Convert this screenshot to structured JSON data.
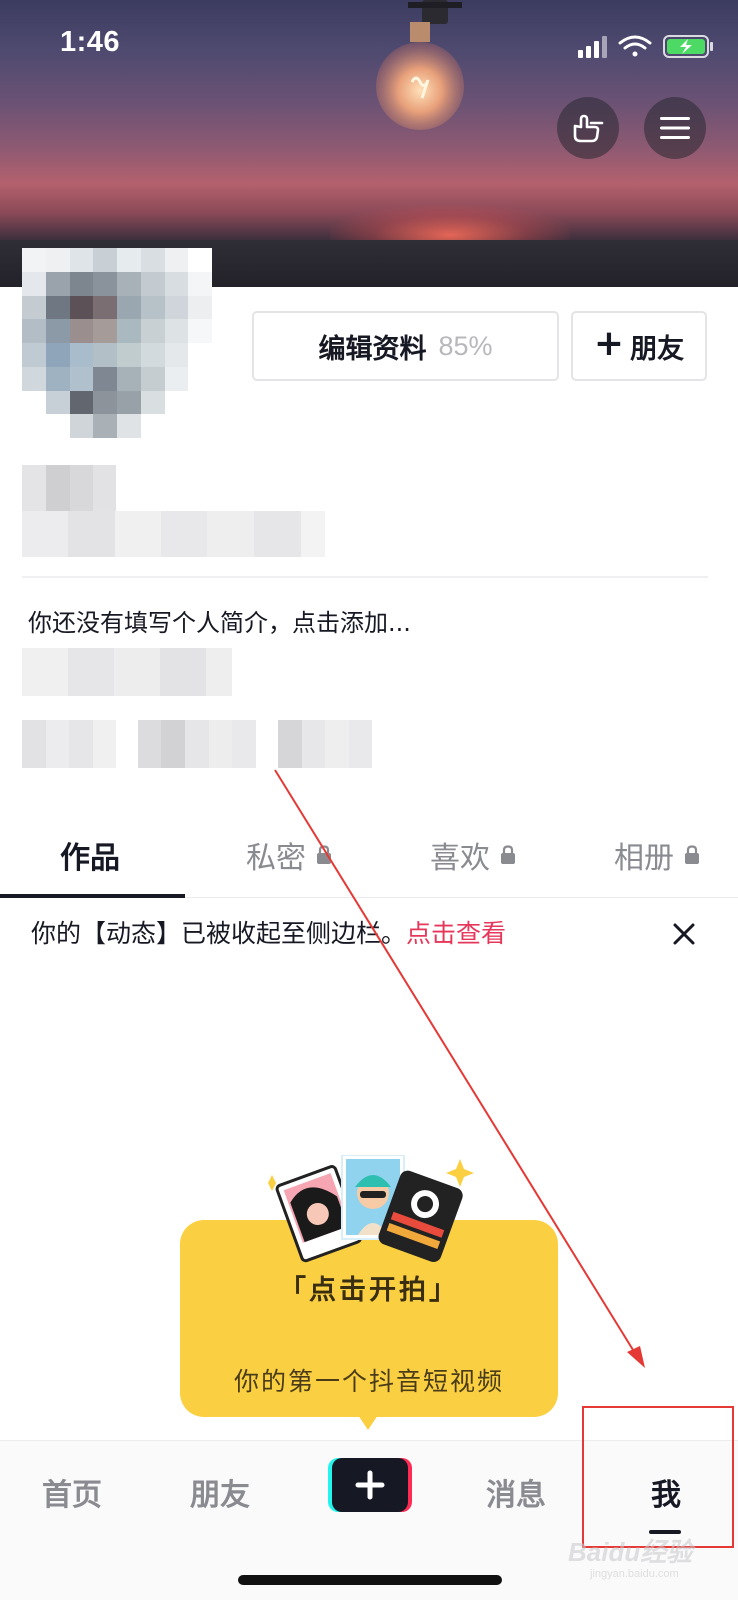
{
  "status_bar": {
    "time": "1:46"
  },
  "profile": {
    "edit_label": "编辑资料",
    "edit_percent": "85%",
    "add_friend_label": "朋友",
    "bio_placeholder": "你还没有填写个人简介，点击添加..."
  },
  "tabs": [
    {
      "label": "作品",
      "active": true,
      "locked": false
    },
    {
      "label": "私密",
      "active": false,
      "locked": true
    },
    {
      "label": "喜欢",
      "active": false,
      "locked": true
    },
    {
      "label": "相册",
      "active": false,
      "locked": true
    }
  ],
  "notice": {
    "text": "你的【动态】已被收起至侧边栏。",
    "link": "点击查看"
  },
  "tooltip": {
    "title": "「点击开拍」",
    "subtitle": "你的第一个抖音短视频"
  },
  "bottom_nav": {
    "home": "首页",
    "friends": "朋友",
    "messages": "消息",
    "me": "我",
    "active": "我"
  },
  "watermark": {
    "brand": "Baidu经验",
    "url": "jingyan.baidu.com"
  },
  "colors": {
    "accent": "#e6375a",
    "tooltip_bg": "#fbcf42",
    "annotation": "#e53935",
    "text_primary": "#161823",
    "text_secondary": "#8a8b91"
  },
  "icons": [
    "gesture-icon",
    "menu-icon",
    "lock-icon",
    "close-icon",
    "plus-icon",
    "lightbulb-icon",
    "signal-icon",
    "wifi-icon",
    "battery-icon"
  ]
}
